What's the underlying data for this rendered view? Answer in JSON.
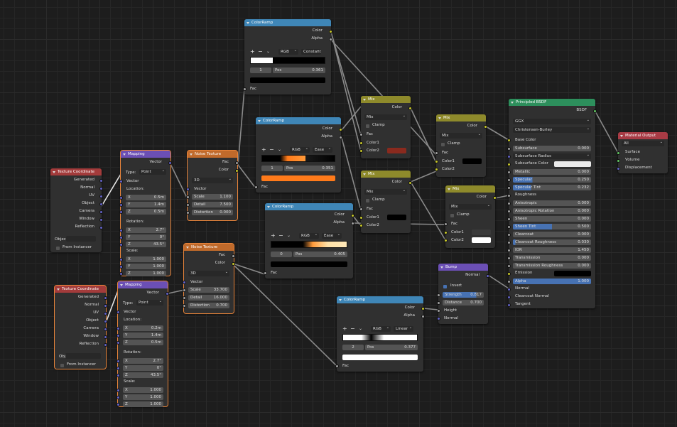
{
  "texcoord1": {
    "title": "Texture Coordinate",
    "outputs": [
      "Generated",
      "Normal",
      "UV",
      "Object",
      "Camera",
      "Window",
      "Reflection"
    ],
    "object_label": "Objec",
    "from_instancer": "From Instancer"
  },
  "texcoord2": {
    "title": "Texture Coordinate",
    "outputs": [
      "Generated",
      "Normal",
      "UV",
      "Object",
      "Camera",
      "Window",
      "Reflection"
    ],
    "object_label": "Object",
    "from_instancer": "From Instancer"
  },
  "mapping1": {
    "title": "Mapping",
    "out": "Vector",
    "type_label": "Type:",
    "type": "Point",
    "vector": "Vector",
    "location": "Location:",
    "rotation": "Rotation:",
    "scale": "Scale:",
    "loc": [
      [
        "X",
        "0.5m"
      ],
      [
        "Y",
        "1.4m"
      ],
      [
        "Z",
        "0.5m"
      ]
    ],
    "rot": [
      [
        "X",
        "2.7°"
      ],
      [
        "Y",
        "0°"
      ],
      [
        "Z",
        "43.5°"
      ]
    ],
    "scl": [
      [
        "X",
        "1.000"
      ],
      [
        "Y",
        "1.000"
      ],
      [
        "Z",
        "1.000"
      ]
    ]
  },
  "mapping2": {
    "title": "Mapping",
    "out": "Vector",
    "type_label": "Type:",
    "type": "Point",
    "vector": "Vector",
    "location": "Location:",
    "rotation": "Rotation:",
    "scale": "Scale:",
    "loc": [
      [
        "X",
        "0.2m"
      ],
      [
        "Y",
        "1.4m"
      ],
      [
        "Z",
        "0.5m"
      ]
    ],
    "rot": [
      [
        "X",
        "2.7°"
      ],
      [
        "Y",
        "0°"
      ],
      [
        "Z",
        "43.5°"
      ]
    ],
    "scl": [
      [
        "X",
        "1.000"
      ],
      [
        "Y",
        "1.000"
      ],
      [
        "Z",
        "1.000"
      ]
    ]
  },
  "noise1": {
    "title": "Noise Texture",
    "fac": "Fac",
    "color": "Color",
    "dim": "3D",
    "vector": "Vector",
    "fields": [
      [
        "Scale",
        "1.100"
      ],
      [
        "Detail",
        "7.500"
      ],
      [
        "Distortion",
        "0.000"
      ]
    ]
  },
  "noise2": {
    "title": "Noise Texture",
    "fac": "Fac",
    "color": "Color",
    "dim": "3D",
    "vector": "Vector",
    "fields": [
      [
        "Scale",
        "33.700"
      ],
      [
        "Detail",
        "16.000"
      ],
      [
        "Distortion",
        "0.700"
      ]
    ]
  },
  "ramp1": {
    "title": "ColorRamp",
    "color": "Color",
    "alpha": "Alpha",
    "mode": "RGB",
    "interp": "Constant",
    "index": "1",
    "pos_label": "Pos",
    "pos": "0.361",
    "fac": "Fac",
    "swatch": "#000000"
  },
  "ramp2": {
    "title": "ColorRamp",
    "color": "Color",
    "alpha": "Alpha",
    "mode": "RGB",
    "interp": "Ease",
    "index": "1",
    "pos_label": "Pos",
    "pos": "0.351",
    "fac": "Fac",
    "swatch": "#ff7a1a"
  },
  "ramp3": {
    "title": "ColorRamp",
    "color": "Color",
    "alpha": "Alpha",
    "mode": "RGB",
    "interp": "Ease",
    "index": "0",
    "pos_label": "Pos",
    "pos": "0.405",
    "fac": "Fac",
    "swatch": "#000000"
  },
  "ramp4": {
    "title": "ColorRamp",
    "color": "Color",
    "alpha": "Alpha",
    "mode": "RGB",
    "interp": "Linear",
    "index": "2",
    "pos_label": "Pos",
    "pos": "0.377",
    "fac": "Fac",
    "swatch": "#ffffff"
  },
  "mix1": {
    "title": "Mix",
    "color": "Color",
    "blend": "Mix",
    "clamp": "Clamp",
    "fac": "Fac",
    "color1": "Color1",
    "color2": "Color2",
    "c2": "#8a2a1e"
  },
  "mix2": {
    "title": "Mix",
    "color": "Color",
    "blend": "Mix",
    "clamp": "Clamp",
    "fac": "Fac",
    "color1": "Color1",
    "color2": "Color2",
    "c1": "#000000"
  },
  "mix3": {
    "title": "Mix",
    "color": "Color",
    "blend": "Mix",
    "clamp": "Clamp",
    "fac": "Fac",
    "color1": "Color1",
    "color2": "Color2",
    "c1": "#000000"
  },
  "mix4": {
    "title": "Mix",
    "color": "Color",
    "blend": "Mix",
    "clamp": "Clamp",
    "fac": "Fac",
    "color1": "Color1",
    "color2": "Color2",
    "c1": "#3a3a3a",
    "c2": "#ffffff"
  },
  "bump": {
    "title": "Bump",
    "normal": "Normal",
    "invert": "Invert",
    "strength": "Strength",
    "strength_v": "0.817",
    "distance": "Distance",
    "distance_v": "0.700",
    "height": "Height",
    "normal_in": "Normal",
    "strength_fill": 0.817
  },
  "bsdf": {
    "title": "Principled BSDF",
    "out": "BSDF",
    "dist": "GGX",
    "sss": "Christensen-Burley",
    "base_color": "Base Color",
    "rows": [
      [
        "Subsurface",
        "0.000",
        0
      ],
      [
        "Subsurface Radius",
        "",
        0
      ],
      [
        "Subsurface Color",
        "",
        0
      ],
      [
        "Metallic",
        "0.000",
        0
      ],
      [
        "Specular",
        "0.250",
        0.25
      ],
      [
        "Specular Tint",
        "0.232",
        0.232
      ],
      [
        "Roughness",
        "",
        0
      ],
      [
        "Anisotropic",
        "0.000",
        0
      ],
      [
        "Anisotropic Rotation",
        "0.000",
        0
      ],
      [
        "Sheen",
        "0.000",
        0
      ],
      [
        "Sheen Tint",
        "0.500",
        0.5
      ],
      [
        "Clearcoat",
        "0.000",
        0
      ],
      [
        "Clearcoat Roughness",
        "0.030",
        0.03
      ],
      [
        "IOR",
        "1.450",
        0
      ],
      [
        "Transmission",
        "0.000",
        0
      ],
      [
        "Transmission Roughness",
        "0.000",
        0
      ],
      [
        "Emission",
        "",
        0
      ],
      [
        "Alpha",
        "1.000",
        1
      ]
    ],
    "tail": [
      "Normal",
      "Clearcoat Normal",
      "Tangent"
    ]
  },
  "output": {
    "title": "Material Output",
    "target": "All",
    "inputs": [
      "Surface",
      "Volume",
      "Displacement"
    ]
  }
}
